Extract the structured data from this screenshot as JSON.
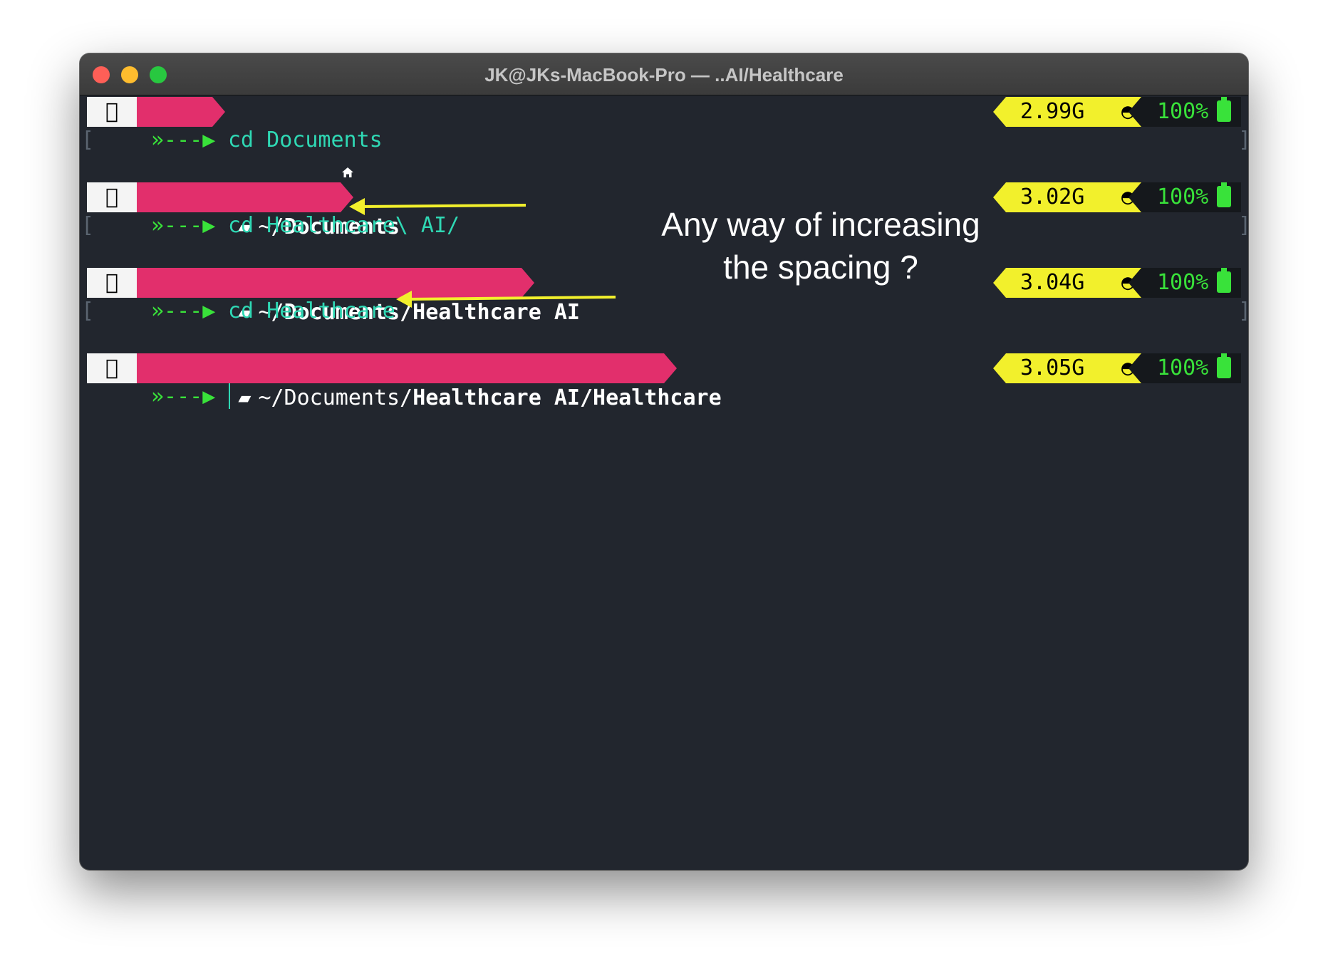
{
  "window": {
    "title": "JK@JKs-MacBook-Pro — ..AI/Healthcare",
    "traffic_lights": [
      "#ff5f57",
      "#febc2e",
      "#28c840"
    ]
  },
  "prompts": [
    {
      "icon": "home-icon",
      "path_dim": "",
      "path_bold": "~",
      "memory": "2.99G",
      "battery": "100%",
      "arrow": "»---▶",
      "command": "cd Documents"
    },
    {
      "icon": "folder-icon",
      "path_dim": "~/",
      "path_bold": "Documents",
      "memory": "3.02G",
      "battery": "100%",
      "arrow": "»---▶",
      "command": "cd Healthcare\\ AI/"
    },
    {
      "icon": "folder-icon",
      "path_dim": "~/",
      "path_bold": "Documents/Healthcare AI",
      "memory": "3.04G",
      "battery": "100%",
      "arrow": "»---▶",
      "command": "cd Healthcare"
    },
    {
      "icon": "folder-icon",
      "path_dim": "~/Documents/",
      "path_bold": "Healthcare AI/Healthcare",
      "memory": "3.05G",
      "battery": "100%",
      "arrow": "»---▶",
      "command": ""
    }
  ],
  "annotation": {
    "line1": "Any way of increasing",
    "line2": "the spacing ?"
  },
  "colors": {
    "terminal_bg": "#22262e",
    "path_segment": "#e22f6c",
    "memory_segment": "#f2f02c",
    "battery_text": "#39e23a",
    "command_text": "#2fd8b4",
    "annotation_arrow": "#f2f02c"
  }
}
